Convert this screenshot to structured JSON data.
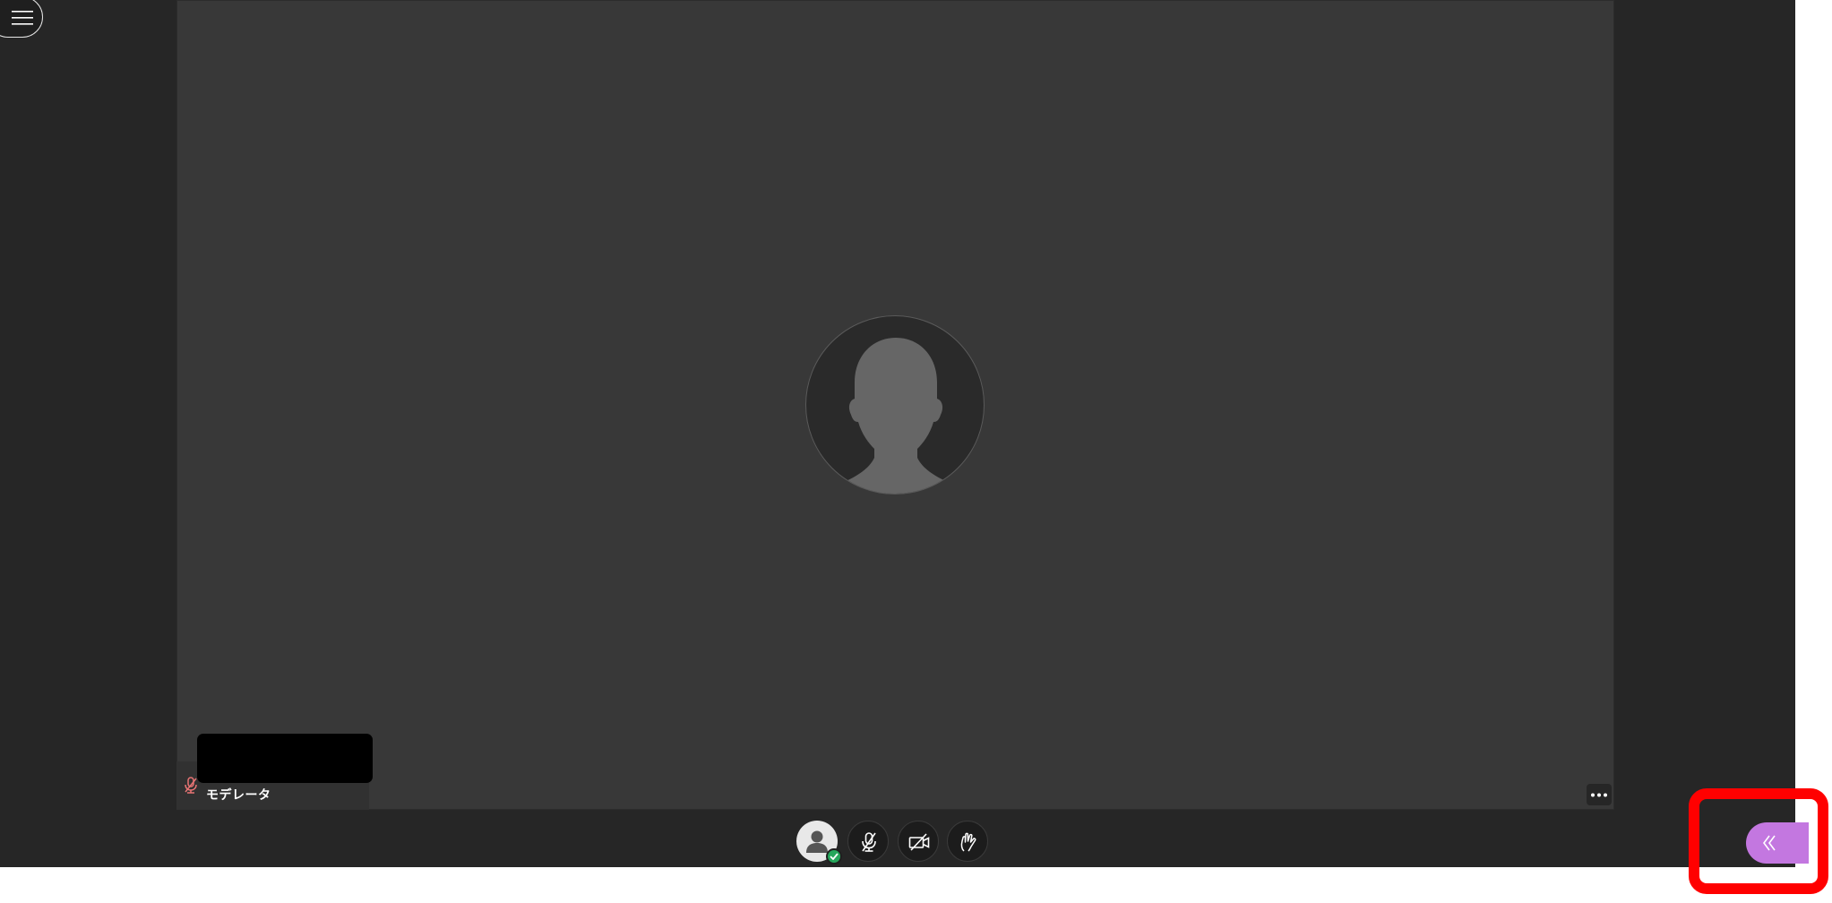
{
  "header": {
    "menu_icon": "hamburger-menu-icon"
  },
  "main_video": {
    "avatar_icon": "default-user-silhouette-icon"
  },
  "participant_tile": {
    "name": "",
    "role": "モデレータ",
    "mic_status_icon": "mic-muted-icon",
    "more_icon": "more-options-icon"
  },
  "toolbar": {
    "profile_icon": "user-profile-icon",
    "profile_status": "connected",
    "mic_icon": "mic-muted-icon",
    "camera_icon": "camera-off-icon",
    "hand_icon": "raise-hand-icon"
  },
  "side_panel": {
    "toggle_icon": "double-chevron-left-icon",
    "toggle_color": "#c377e0"
  },
  "annotation": {
    "highlight_color": "#ff0000"
  }
}
